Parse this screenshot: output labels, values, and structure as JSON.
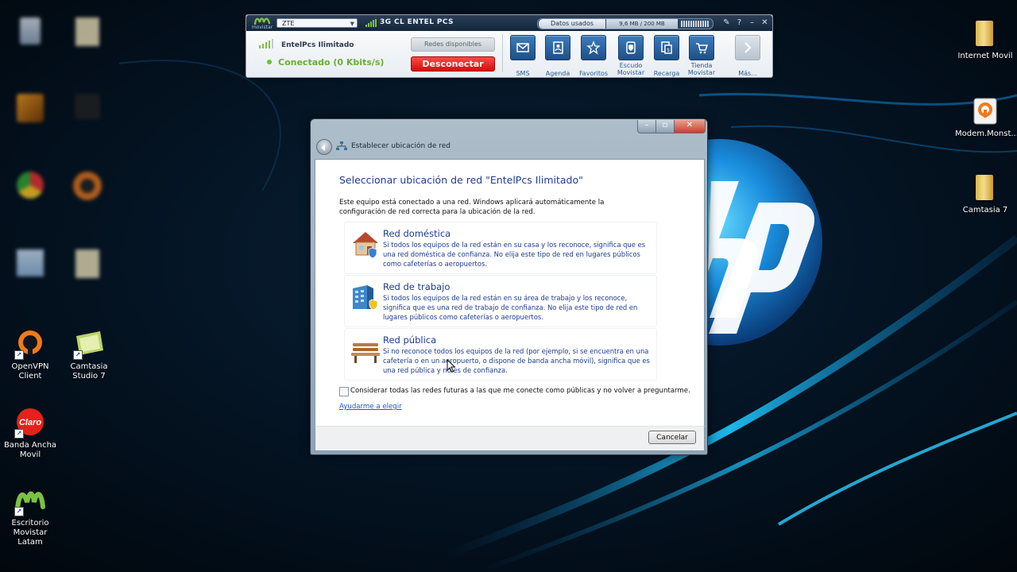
{
  "desktop": {
    "icons_right": [
      {
        "label": "Internet Movil"
      },
      {
        "label": "Modem.Monst..."
      },
      {
        "label": "Camtasia 7"
      }
    ],
    "icons_left": [
      {
        "label": "OpenVPN Client"
      },
      {
        "label": "Camtasia Studio 7"
      },
      {
        "label": "Banda Ancha Movil"
      },
      {
        "label": "Escritorio Movistar Latam"
      }
    ],
    "colors": {
      "wallpaper": "#020a14",
      "glow": "#18b8ff"
    }
  },
  "movistar": {
    "logo": "movistar",
    "device": "ZTE",
    "operator": "3G CL ENTEL PCS",
    "usage_label": "Datos usados",
    "usage_value": "9,6 MB / 200 MB",
    "connection_name": "EntelPcs Ilimitado",
    "status": "Conectado (0 Kbits/s)",
    "networks_button": "Redes disponibles",
    "disconnect_button": "Desconectar",
    "toolbar": [
      {
        "label": "SMS",
        "icon": "envelope-icon"
      },
      {
        "label": "Agenda",
        "icon": "address-book-icon"
      },
      {
        "label": "Favoritos",
        "icon": "star-icon"
      },
      {
        "label": "Escudo Movistar",
        "icon": "shield-icon"
      },
      {
        "label": "Recarga",
        "icon": "recharge-icon"
      },
      {
        "label": "Tienda Movistar",
        "icon": "cart-icon"
      },
      {
        "label": "Más...",
        "icon": "chevron-right-icon"
      }
    ],
    "colors": {
      "accent": "#2b5c92",
      "disconnect": "#e01010",
      "status": "#66b033"
    }
  },
  "dialog": {
    "window_title": "Establecer ubicación de red",
    "heading": "Seleccionar ubicación de red \"EntelPcs Ilimitado\"",
    "intro": "Este equipo está conectado a una red. Windows aplicará automáticamente la configuración de red correcta para la ubicación de la red.",
    "options": [
      {
        "name": "Red doméstica",
        "icon": "house-icon",
        "desc": "Si todos los equipos de la red están en su casa y los reconoce, significa que es una red doméstica de confianza. No elija este tipo de red en lugares públicos como cafeterías o aeropuertos."
      },
      {
        "name": "Red de trabajo",
        "icon": "office-building-icon",
        "desc": "Si todos los equipos de la red están en su área de trabajo y los reconoce, significa que es una red de trabajo de confianza. No elija este tipo de red en lugares públicos como cafeterías o aeropuertos."
      },
      {
        "name": "Red pública",
        "icon": "park-bench-icon",
        "desc": "Si no reconoce todos los equipos de la red (por ejemplo, si se encuentra en una cafetería o en un aeropuerto, o dispone de banda ancha móvil), significa que es una red pública y no es de confianza."
      }
    ],
    "checkbox_label": "Considerar todas las redes futuras a las que me conecte como públicas y no volver a preguntarme.",
    "checkbox_checked": false,
    "help_link": "Ayudarme a elegir",
    "cancel_button": "Cancelar",
    "colors": {
      "link": "#1e57c4",
      "heading": "#1e3d8f"
    }
  }
}
